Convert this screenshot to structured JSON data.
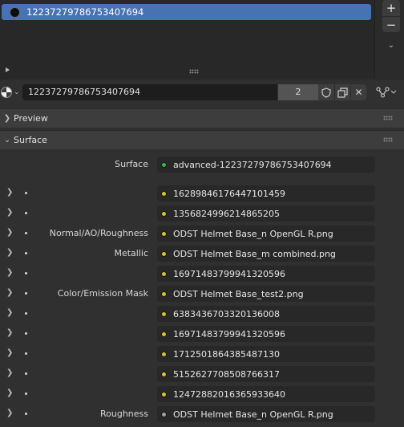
{
  "material_slots": {
    "active_slot": "12237279786753407694",
    "add_button": "+",
    "remove_button": "−",
    "specials_menu": "⌄"
  },
  "material_bar": {
    "name": "12237279786753407694",
    "users": "2",
    "close_glyph": "✕",
    "browse_caret": "⌄"
  },
  "panels": {
    "preview": {
      "title": "Preview",
      "expanded": false
    },
    "surface": {
      "title": "Surface",
      "expanded": true
    }
  },
  "surface": {
    "label": "Surface",
    "value": "advanced-12237279786753407694",
    "socket_color": "#3fb64a"
  },
  "inputs": [
    {
      "label": "",
      "value": "16289846176447101459",
      "socket_color": "#d7c52a"
    },
    {
      "label": "",
      "value": "1356824996214865205",
      "socket_color": "#d7c52a"
    },
    {
      "label": "Normal/AO/Roughness",
      "value": "ODST Helmet Base_n OpenGL R.png",
      "socket_color": "#d7c52a"
    },
    {
      "label": "Metallic",
      "value": "ODST Helmet Base_m combined.png",
      "socket_color": "#d7c52a"
    },
    {
      "label": "",
      "value": "16971483799941320596",
      "socket_color": "#d7c52a"
    },
    {
      "label": "Color/Emission Mask",
      "value": "ODST Helmet Base_test2.png",
      "socket_color": "#d7c52a"
    },
    {
      "label": "",
      "value": "6383436703320136008",
      "socket_color": "#d7c52a"
    },
    {
      "label": "",
      "value": "16971483799941320596",
      "socket_color": "#d7c52a"
    },
    {
      "label": "",
      "value": "1712501864385487130",
      "socket_color": "#d7c52a"
    },
    {
      "label": "",
      "value": "5152627708508766317",
      "socket_color": "#d7c52a"
    },
    {
      "label": "",
      "value": "12472882016365933640",
      "socket_color": "#d7c52a"
    },
    {
      "label": "Roughness",
      "value": "ODST Helmet Base_n OpenGL R.png",
      "socket_color": "#a0a0a0"
    }
  ],
  "colors": {
    "accent_selected": "#4772b3",
    "background": "#303030",
    "field": "#282828"
  }
}
